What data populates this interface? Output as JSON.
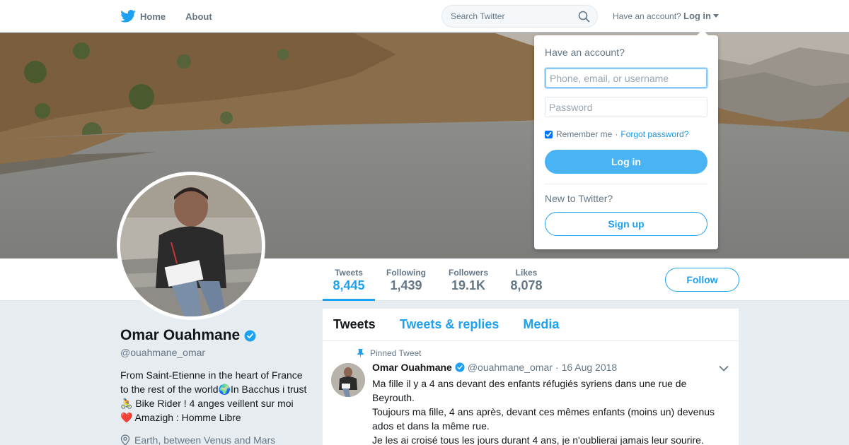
{
  "nav": {
    "home_label": "Home",
    "about_label": "About",
    "search_placeholder": "Search Twitter",
    "have_account": "Have an account?",
    "login_label": "Log in"
  },
  "profile": {
    "name": "Omar Ouahmane",
    "handle": "@ouahmane_omar",
    "bio": "From Saint-Etienne in the heart of France to the rest of the world🌍In Bacchus i trust 🚴 Bike Rider ! 4 anges veillent sur moi ❤️ Amazigh : Homme Libre",
    "location": "Earth, between Venus and Mars",
    "follow_label": "Follow",
    "stats": [
      {
        "label": "Tweets",
        "value": "8,445",
        "active": true
      },
      {
        "label": "Following",
        "value": "1,439",
        "active": false
      },
      {
        "label": "Followers",
        "value": "19.1K",
        "active": false
      },
      {
        "label": "Likes",
        "value": "8,078",
        "active": false
      }
    ]
  },
  "timeline": {
    "tabs": [
      "Tweets",
      "Tweets & replies",
      "Media"
    ],
    "active_tab": "Tweets",
    "pinned_label": "Pinned Tweet",
    "tweet": {
      "name": "Omar Ouahmane",
      "handle": "@ouahmane_omar",
      "dot": "·",
      "date": "16 Aug 2018",
      "text": "Ma fille il y a 4 ans devant des enfants réfugiés syriens dans une rue de Beyrouth.\nToujours ma fille, 4 ans après, devant ces mêmes enfants (moins un) devenus ados et dans la même rue.\n Je les ai croisé tous les jours durant 4 ans, je n'oublierai jamais leur sourire."
    }
  },
  "login_dropdown": {
    "title": "Have an account?",
    "username_placeholder": "Phone, email, or username",
    "password_placeholder": "Password",
    "remember_label": "Remember me",
    "separator": "·",
    "forgot_label": "Forgot password?",
    "login_button": "Log in",
    "new_label": "New to Twitter?",
    "signup_button": "Sign up",
    "remember_checked": true
  },
  "colors": {
    "accent": "#1da1f2",
    "login_button": "#4ab3f4",
    "background": "#e6ecf0"
  },
  "icons": [
    "twitter-bird-icon",
    "search-icon",
    "caret-down-icon",
    "verified-icon",
    "location-pin-icon",
    "pin-icon",
    "chevron-down-icon"
  ]
}
